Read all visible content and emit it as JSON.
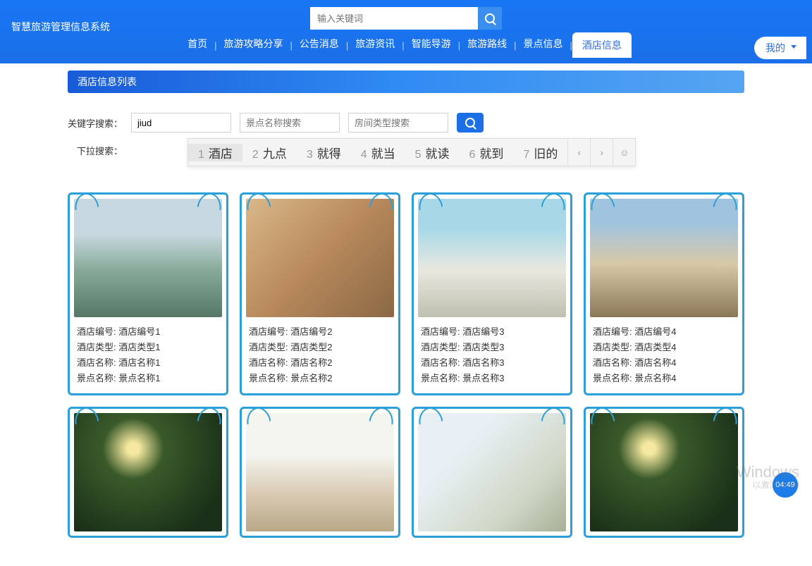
{
  "site_title": "智慧旅游管理信息系统",
  "top_search": {
    "placeholder": "输入关键词"
  },
  "nav": {
    "items": [
      "首页",
      "旅游攻略分享",
      "公告消息",
      "旅游资讯",
      "智能导游",
      "旅游路线",
      "景点信息",
      "酒店信息"
    ],
    "active_index": 7,
    "my_label": "我的"
  },
  "section_title": "酒店信息列表",
  "filters": {
    "keyword_label": "关键字搜索：",
    "dropdown_label": "下拉搜索：",
    "input1_value": "jiud",
    "input2_placeholder": "景点名称搜索",
    "input3_placeholder": "房间类型搜索"
  },
  "ime": {
    "candidates": [
      {
        "num": "1",
        "text": "酒店"
      },
      {
        "num": "2",
        "text": "九点"
      },
      {
        "num": "3",
        "text": "就得"
      },
      {
        "num": "4",
        "text": "就当"
      },
      {
        "num": "5",
        "text": "就读"
      },
      {
        "num": "6",
        "text": "就到"
      },
      {
        "num": "7",
        "text": "旧的"
      }
    ]
  },
  "labels": {
    "hotel_code": "酒店编号:",
    "hotel_type": "酒店类型:",
    "hotel_name": "酒店名称:",
    "spot_name": "景点名称:"
  },
  "cards": [
    {
      "code": "酒店编号1",
      "type": "酒店类型1",
      "name": "酒店名称1",
      "spot": "景点名称1",
      "img": "img1"
    },
    {
      "code": "酒店编号2",
      "type": "酒店类型2",
      "name": "酒店名称2",
      "spot": "景点名称2",
      "img": "img2"
    },
    {
      "code": "酒店编号3",
      "type": "酒店类型3",
      "name": "酒店名称3",
      "spot": "景点名称3",
      "img": "img3"
    },
    {
      "code": "酒店编号4",
      "type": "酒店类型4",
      "name": "酒店名称4",
      "spot": "景点名称4",
      "img": "img4"
    },
    {
      "code": "",
      "type": "",
      "name": "",
      "spot": "",
      "img": "img5"
    },
    {
      "code": "",
      "type": "",
      "name": "",
      "spot": "",
      "img": "img6"
    },
    {
      "code": "",
      "type": "",
      "name": "",
      "spot": "",
      "img": "img7"
    },
    {
      "code": "",
      "type": "",
      "name": "",
      "spot": "",
      "img": "img5"
    }
  ],
  "video_time": "04:49",
  "watermark": {
    "title": "Windows",
    "sub": "以激活 Wind"
  }
}
